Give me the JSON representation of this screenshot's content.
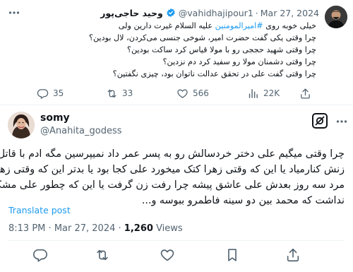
{
  "quoted_tweet": {
    "display_name": "وحید حاجی‌پور",
    "handle": "@vahidhajipour1",
    "separator": "·",
    "date": "Mar 27, 2024",
    "body_lines": [
      {
        "pre": "خیلی خوبه روی ",
        "hashtag": "#امیرالمومنین",
        "post": " علیه السلام غیرت دارین ولی"
      },
      {
        "text": "چرا وقتی یکی گفت حضرت امیر، شوخی جنسی می‌کردن، لال بودین؟"
      },
      {
        "text": "چرا وقتی شهید حججی رو با مولا قیاس کرد ساکت بودین؟"
      },
      {
        "text": "چرا وقتی دشمنان مولا رو سفید کرد دم نزدین؟"
      },
      {
        "text": "چرا وقتی  گفت علی در تحقق عدالت ناتوان بود، چیزی نگفتین؟"
      }
    ],
    "actions": {
      "replies": "35",
      "reposts": "33",
      "likes": "566",
      "views": "22K"
    }
  },
  "reply_tweet": {
    "display_name": "somy",
    "handle": "@Anahita_godess",
    "body_lines": [
      "چرا وقتی میگیم علی دختر خردسالش رو به پسر عمر داد نمیپرسین مگه ادم با قاتل",
      "زنش کنارمیاد یا این که وقتی زهرا کتک میخورد علی کجا بود یا بدتر این که وقتی زهرا",
      "مرد سه روز بعدش علی عاشق پیشه چرا رفت زن گرفت یا این که چطور علی مشکلی",
      "نداشت که محمد بین دو سینه فاطمرو ببوسه و..."
    ],
    "translate_label": "Translate post",
    "time": "8:13 PM",
    "date": "Mar 27, 2024",
    "views_count": "1,260",
    "views_label": "Views",
    "separator": "·"
  },
  "colors": {
    "text": "#0f1419",
    "secondary": "#536471",
    "link": "#1d9bf0",
    "verified": "#1d9bf0",
    "divider": "#eff3f4"
  }
}
